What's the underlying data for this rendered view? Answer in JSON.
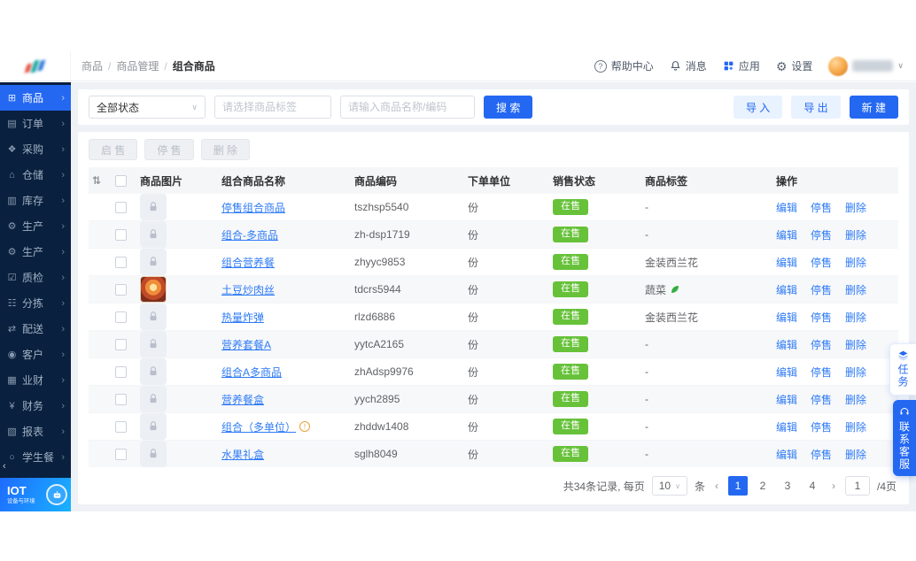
{
  "header": {
    "breadcrumb": [
      "商品",
      "商品管理",
      "组合商品"
    ],
    "help_label": "帮助中心",
    "messages_label": "消息",
    "apps_label": "应用",
    "settings_label": "设置"
  },
  "sidebar": {
    "items": [
      {
        "id": "goods",
        "label": "商品",
        "icon": "goods-icon",
        "active": true
      },
      {
        "id": "orders",
        "label": "订单",
        "icon": "orders-icon",
        "active": false
      },
      {
        "id": "purchase",
        "label": "采购",
        "icon": "purchase-icon",
        "active": false
      },
      {
        "id": "warehouse",
        "label": "仓储",
        "icon": "warehouse-icon",
        "active": false
      },
      {
        "id": "inventory",
        "label": "库存",
        "icon": "inventory-icon",
        "active": false
      },
      {
        "id": "production-1",
        "label": "生产",
        "icon": "production-icon",
        "active": false
      },
      {
        "id": "production-2",
        "label": "生产",
        "icon": "production-icon",
        "active": false
      },
      {
        "id": "quality-check",
        "label": "质检",
        "icon": "quality-icon",
        "active": false
      },
      {
        "id": "sorting",
        "label": "分拣",
        "icon": "sorting-icon",
        "active": false
      },
      {
        "id": "delivery",
        "label": "配送",
        "icon": "delivery-icon",
        "active": false
      },
      {
        "id": "customers",
        "label": "客户",
        "icon": "customers-icon",
        "active": false
      },
      {
        "id": "business-finance",
        "label": "业财",
        "icon": "business-finance-icon",
        "active": false
      },
      {
        "id": "finance",
        "label": "财务",
        "icon": "finance-icon",
        "active": false
      },
      {
        "id": "reports",
        "label": "报表",
        "icon": "reports-icon",
        "active": false
      },
      {
        "id": "student-meal",
        "label": "学生餐",
        "icon": "student-meal-icon",
        "active": false
      }
    ],
    "brand": {
      "title": "IOT",
      "subtitle": "设备与环境"
    }
  },
  "filters": {
    "status_value": "全部状态",
    "tag_placeholder": "请选择商品标签",
    "keyword_placeholder": "请输入商品名称/编码",
    "search_label": "搜 索",
    "import_label": "导 入",
    "export_label": "导 出",
    "create_label": "新 建"
  },
  "toolbar": {
    "enable_label": "启 售",
    "disable_label": "停 售",
    "delete_label": "删 除"
  },
  "table": {
    "columns": [
      "商品图片",
      "组合商品名称",
      "商品编码",
      "下单单位",
      "销售状态",
      "商品标签",
      "操作"
    ],
    "actions": [
      "编辑",
      "停售",
      "删除"
    ],
    "status_color": "#67c23a",
    "rows": [
      {
        "name": "停售组合商品",
        "code": "tszhsp5540",
        "unit": "份",
        "status": "在售",
        "tag": "-",
        "photo": false,
        "info": false,
        "leaf": false
      },
      {
        "name": "组合-多商品",
        "code": "zh-dsp1719",
        "unit": "份",
        "status": "在售",
        "tag": "-",
        "photo": false,
        "info": false,
        "leaf": false
      },
      {
        "name": "组合营养餐",
        "code": "zhyyc9853",
        "unit": "份",
        "status": "在售",
        "tag": "金装西兰花",
        "photo": false,
        "info": false,
        "leaf": false
      },
      {
        "name": "土豆炒肉丝",
        "code": "tdcrs5944",
        "unit": "份",
        "status": "在售",
        "tag": "蔬菜",
        "photo": true,
        "info": false,
        "leaf": true
      },
      {
        "name": "热量炸弹",
        "code": "rlzd6886",
        "unit": "份",
        "status": "在售",
        "tag": "金装西兰花",
        "photo": false,
        "info": false,
        "leaf": false
      },
      {
        "name": "营养套餐A",
        "code": "yytcA2165",
        "unit": "份",
        "status": "在售",
        "tag": "-",
        "photo": false,
        "info": false,
        "leaf": false
      },
      {
        "name": "组合A多商品",
        "code": "zhAdsp9976",
        "unit": "份",
        "status": "在售",
        "tag": "-",
        "photo": false,
        "info": false,
        "leaf": false
      },
      {
        "name": "营养餐盒",
        "code": "yych2895",
        "unit": "份",
        "status": "在售",
        "tag": "-",
        "photo": false,
        "info": false,
        "leaf": false
      },
      {
        "name": "组合（多单位）",
        "code": "zhddw1408",
        "unit": "份",
        "status": "在售",
        "tag": "-",
        "photo": false,
        "info": true,
        "leaf": false
      },
      {
        "name": "水果礼盒",
        "code": "sglh8049",
        "unit": "份",
        "status": "在售",
        "tag": "-",
        "photo": false,
        "info": false,
        "leaf": false
      }
    ]
  },
  "pagination": {
    "total_label": "共34条记录, 每页",
    "page_size": "10",
    "size_unit": "条",
    "prev": "‹",
    "next": "›",
    "pages": [
      "1",
      "2",
      "3",
      "4"
    ],
    "current": "1",
    "jump_value": "1",
    "jump_suffix": "/4页"
  },
  "floating": {
    "task_label": "任务",
    "service_label": "联系客服"
  }
}
